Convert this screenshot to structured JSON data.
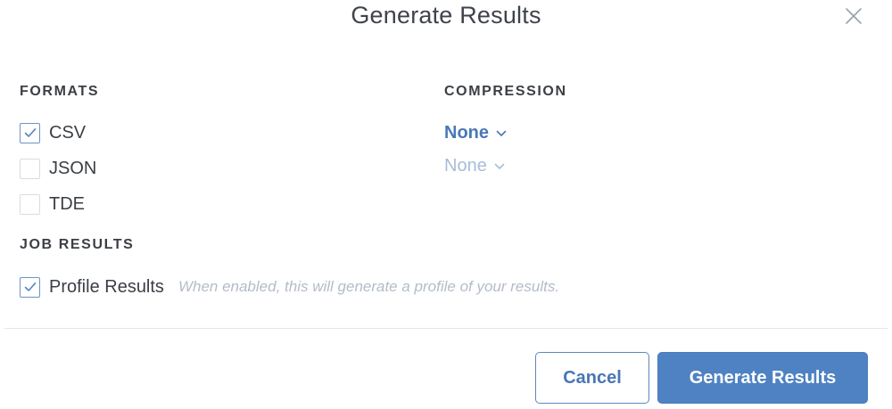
{
  "dialog": {
    "title": "Generate Results",
    "close_icon": "close-icon"
  },
  "formats": {
    "label": "FORMATS",
    "options": [
      {
        "label": "CSV",
        "checked": true
      },
      {
        "label": "JSON",
        "checked": false
      },
      {
        "label": "TDE",
        "checked": false
      }
    ]
  },
  "compression": {
    "label": "COMPRESSION",
    "selects": [
      {
        "value": "None",
        "enabled": true
      },
      {
        "value": "None",
        "enabled": false
      }
    ]
  },
  "job_results": {
    "label": "JOB RESULTS",
    "profile": {
      "label": "Profile Results",
      "checked": true,
      "hint": "When enabled, this will generate a profile of your results."
    }
  },
  "footer": {
    "cancel_label": "Cancel",
    "generate_label": "Generate Results"
  },
  "colors": {
    "accent": "#4f82c2",
    "link": "#4a78b6",
    "disabled": "#a8bdd6",
    "hint": "#b3bcc8"
  }
}
